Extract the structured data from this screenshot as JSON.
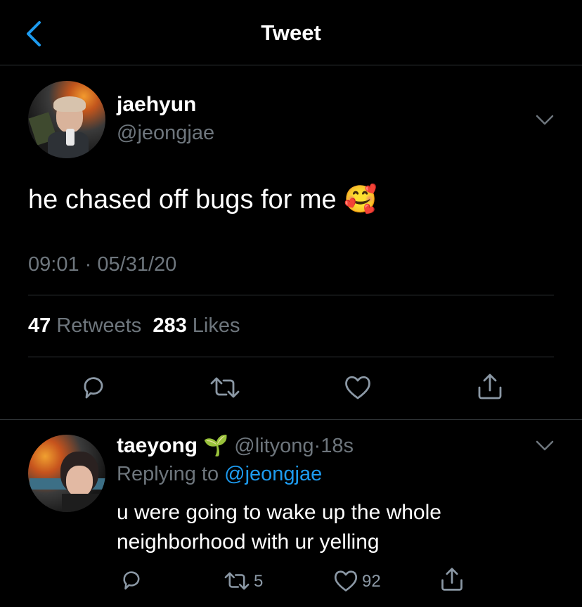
{
  "header": {
    "title": "Tweet"
  },
  "tweet": {
    "display_name": "jaehyun",
    "handle": "@jeongjae",
    "text": "he chased off bugs for me",
    "emoji": "🥰",
    "time": "09:01",
    "dot": "·",
    "date": "05/31/20",
    "retweets_count": "47",
    "retweets_label": "Retweets",
    "likes_count": "283",
    "likes_label": "Likes"
  },
  "reply": {
    "display_name": "taeyong",
    "badge_emoji": "🌱",
    "handle": "@lityong",
    "dot": "·",
    "age": "18s",
    "replying_to_label": "Replying to",
    "replying_to_handle": "@jeongjae",
    "text": "u were going to wake up the whole neighborhood with ur yelling",
    "retweets_count": "5",
    "likes_count": "92"
  },
  "colors": {
    "background": "#000000",
    "accent": "#1d9bf0",
    "secondary_text": "#6e767d",
    "divider": "#2f3336"
  }
}
